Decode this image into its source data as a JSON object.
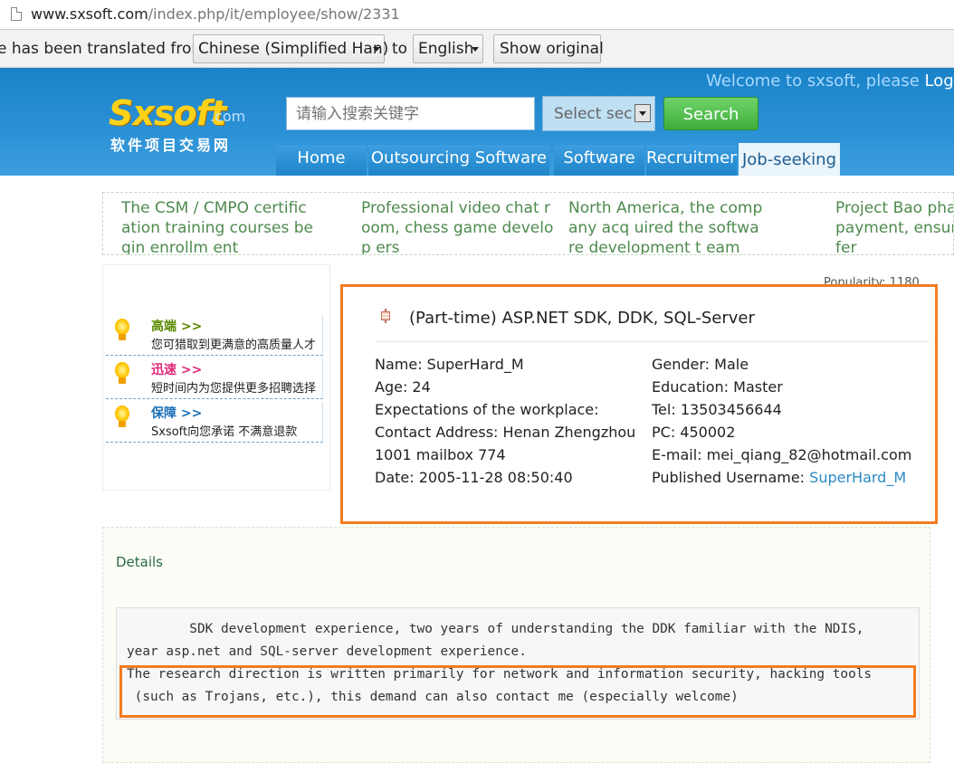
{
  "browser": {
    "url_host": "www.sxsoft.com",
    "url_path": "/index.php/it/employee/show/2331"
  },
  "translate_bar": {
    "prefix_text": "e has been translated from",
    "from_language": "Chinese (Simplified Han)",
    "to_text": "to",
    "to_language": "English",
    "show_original_label": "Show original"
  },
  "header": {
    "welcome_text": "Welcome to sxsoft, please",
    "login_text": "Log",
    "logo_main": "Sxsoft",
    "logo_com": ".com",
    "logo_subtitle": "软件项目交易网",
    "search_placeholder": "请输入搜索关键字",
    "select_label": "Select sec",
    "search_button": "Search"
  },
  "nav": {
    "tabs": [
      {
        "label": "Home",
        "active": false
      },
      {
        "label": "Outsourcing Software",
        "active": false
      },
      {
        "label": "Software",
        "active": false
      },
      {
        "label": "Recruitmen",
        "active": false
      },
      {
        "label": "Job-seeking",
        "active": true
      }
    ]
  },
  "news": [
    "The CSM / CMPO certification training courses begin enrollm ent",
    "Professional video chat r oom, chess game develop ers",
    "North America, the company acq uired the software development t eam",
    "Project Bao pha payment, ensuri fer"
  ],
  "sidebar": {
    "items": [
      {
        "title": "高端 >>",
        "desc": "您可猎取到更满意的高质量人才",
        "color": "#5a8a00"
      },
      {
        "title": "迅速 >>",
        "desc": "短时间内为您提供更多招聘选择",
        "color": "#e0297a"
      },
      {
        "title": "保障 >>",
        "desc": "Sxsoft向您承诺 不满意退款",
        "color": "#1d6fb8"
      }
    ]
  },
  "popularity": "Popularity: 1180",
  "profile": {
    "heading": "(Part-time) ASP.NET SDK, DDK, SQL-Server",
    "name": "Name: SuperHard_M",
    "age": "Age: 24",
    "expectations": "Expectations of the workplace:",
    "contact_address": "Contact Address: Henan Zhengzhou",
    "contact_address_2": "1001 mailbox 774",
    "date": "Date: 2005-11-28 08:50:40",
    "gender": "Gender: Male",
    "education": "Education: Master",
    "tel": "Tel: 13503456644",
    "pc": "PC: 450002",
    "email": "E-mail: mei_qiang_82@hotmail.com",
    "published_label": "Published Username:",
    "published_user": "SuperHard_M"
  },
  "details": {
    "label": "Details",
    "lines": [
      "        SDK development experience, two years of understanding the DDK familiar with the NDIS,",
      "year asp.net and SQL-server development experience.",
      "The research direction is written primarily for network and information security, hacking tools",
      " (such as Trojans, etc.), this demand can also contact me (especially welcome)"
    ]
  },
  "colors": {
    "highlight": "#f47c20",
    "header_blue": "#2b91d6",
    "search_green": "#3fae3a"
  }
}
